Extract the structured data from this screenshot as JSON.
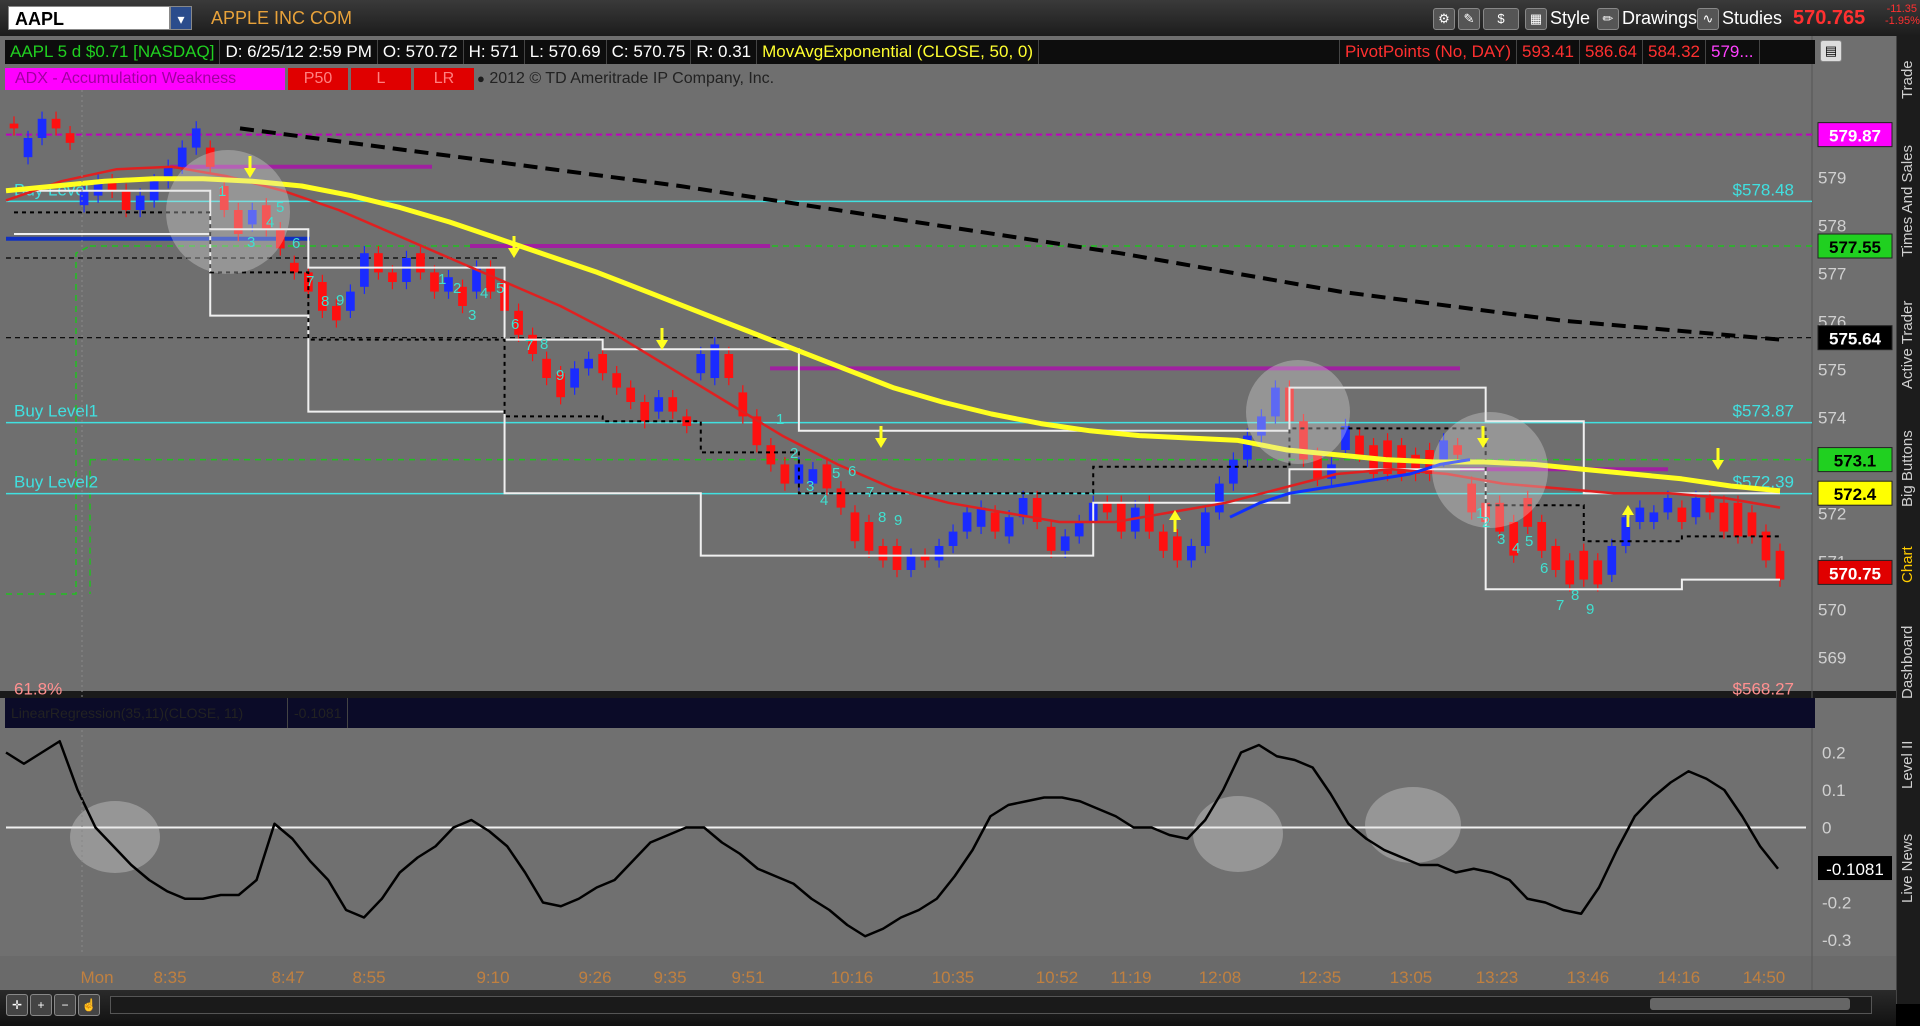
{
  "toolbar": {
    "symbol": "AAPL",
    "company": "APPLE INC COM",
    "style_label": "Style",
    "drawings_label": "Drawings",
    "studies_label": "Studies",
    "last_price": "570.765",
    "net_change": "-11.35",
    "net_change_pct": "-1.95%"
  },
  "info_bar": {
    "symbol_info": "AAPL 5 d $0.71 [NASDAQ]",
    "date": "D: 6/25/12 2:59 PM",
    "open": "O: 570.72",
    "high": "H: 571",
    "low": "L: 570.69",
    "close": "C: 570.75",
    "range": "R: 0.31",
    "mov_avg": "MovAvgExponential (CLOSE, 50, 0)",
    "pivot_label": "PivotPoints (No, DAY)",
    "pivot_values": [
      "593.41",
      "586.64",
      "584.32",
      "579..."
    ]
  },
  "study_bar": {
    "accdist": "ADX - Accumulation Weakness",
    "tags": [
      "P50",
      "L",
      "LR"
    ],
    "copyright": "2012 © TD Ameritrade IP Company, Inc."
  },
  "lower_header": {
    "study": "LinearRegression(35,11)(CLOSE, 11)",
    "value": "-0.1081"
  },
  "right_tabs": [
    "Trade",
    "Times And Sales",
    "Active Trader",
    "Big Buttons",
    "Chart",
    "Dashboard",
    "Level II",
    "Live News"
  ],
  "chart_data": [
    {
      "type": "candlestick",
      "y_ticks": [
        569,
        570,
        571,
        572,
        573,
        574,
        575,
        576,
        577,
        578,
        579
      ],
      "ylim": [
        568.3,
        580.8
      ],
      "x_ticks": [
        "Mon",
        "8:35",
        "8:47",
        "8:55",
        "9:10",
        "9:26",
        "9:35",
        "9:51",
        "10:16",
        "10:35",
        "10:52",
        "11:19",
        "12:08",
        "12:35",
        "13:05",
        "13:23",
        "13:46",
        "14:16",
        "14:50"
      ],
      "reference_lines": [
        {
          "label": "Buy Level",
          "value": "$578.48",
          "y": 578.48,
          "color": "#40e0e0"
        },
        {
          "label": "Buy Level1",
          "value": "$573.87",
          "y": 573.87,
          "color": "#40e0e0"
        },
        {
          "label": "Buy Level2",
          "value": "$572.39",
          "y": 572.39,
          "color": "#40e0e0"
        },
        {
          "label": "61.8%",
          "value": "$568.27",
          "y": 568.27,
          "color": "#ff9090"
        }
      ],
      "price_bubbles": [
        {
          "value": "579.87",
          "y": 579.87,
          "bg": "#ff00ff",
          "fg": "#ffffff"
        },
        {
          "value": "577.55",
          "y": 577.55,
          "bg": "#20d020",
          "fg": "#000000"
        },
        {
          "value": "575.64",
          "y": 575.64,
          "bg": "#000000",
          "fg": "#ffffff"
        },
        {
          "value": "573.1",
          "y": 573.1,
          "bg": "#20d020",
          "fg": "#000000"
        },
        {
          "value": "572.4",
          "y": 572.4,
          "bg": "#ffff00",
          "fg": "#000000"
        },
        {
          "value": "570.75",
          "y": 570.75,
          "bg": "#e00000",
          "fg": "#ffffff"
        }
      ],
      "candles": [
        [
          580.1,
          580.0
        ],
        [
          579.4,
          579.8
        ],
        [
          579.8,
          580.2
        ],
        [
          580.2,
          580.0
        ],
        [
          579.9,
          579.7
        ],
        [
          578.4,
          578.7
        ],
        [
          578.6,
          578.9
        ],
        [
          578.9,
          578.7
        ],
        [
          578.7,
          578.3
        ],
        [
          578.3,
          578.6
        ],
        [
          578.5,
          578.9
        ],
        [
          578.9,
          579.2
        ],
        [
          579.2,
          579.6
        ],
        [
          579.6,
          580.0
        ],
        [
          579.6,
          579.2
        ],
        [
          578.8,
          578.3
        ],
        [
          578.3,
          577.8
        ],
        [
          578.0,
          578.3
        ],
        [
          578.4,
          577.9
        ],
        [
          577.9,
          577.5
        ],
        [
          577.2,
          577.0
        ],
        [
          577.0,
          576.6
        ],
        [
          576.8,
          576.2
        ],
        [
          576.3,
          576.0
        ],
        [
          576.2,
          576.6
        ],
        [
          576.7,
          577.4
        ],
        [
          577.4,
          577.0
        ],
        [
          577.0,
          576.8
        ],
        [
          576.8,
          577.3
        ],
        [
          577.4,
          577.0
        ],
        [
          577.0,
          576.6
        ],
        [
          576.6,
          576.9
        ],
        [
          576.7,
          576.3
        ],
        [
          576.6,
          577.1
        ],
        [
          577.1,
          576.6
        ],
        [
          576.8,
          576.2
        ],
        [
          576.2,
          575.7
        ],
        [
          575.7,
          575.3
        ],
        [
          575.2,
          574.8
        ],
        [
          574.9,
          574.4
        ],
        [
          574.6,
          575.0
        ],
        [
          575.0,
          575.2
        ],
        [
          575.3,
          574.9
        ],
        [
          574.9,
          574.6
        ],
        [
          574.6,
          574.3
        ],
        [
          574.3,
          573.9
        ],
        [
          574.1,
          574.4
        ],
        [
          574.4,
          574.1
        ],
        [
          574.0,
          573.8
        ],
        [
          574.9,
          575.3
        ],
        [
          574.8,
          575.5
        ],
        [
          575.3,
          574.8
        ],
        [
          574.5,
          574.0
        ],
        [
          574.0,
          573.4
        ],
        [
          573.4,
          573.0
        ],
        [
          573.0,
          572.6
        ],
        [
          572.6,
          573.0
        ],
        [
          572.6,
          572.9
        ],
        [
          573.0,
          572.5
        ],
        [
          572.5,
          572.1
        ],
        [
          572.0,
          571.4
        ],
        [
          571.8,
          571.2
        ],
        [
          571.3,
          571.0
        ],
        [
          571.3,
          570.8
        ],
        [
          570.8,
          571.1
        ],
        [
          571.1,
          571.0
        ],
        [
          571.0,
          571.3
        ],
        [
          571.3,
          571.6
        ],
        [
          571.6,
          572.0
        ],
        [
          571.7,
          572.1
        ],
        [
          572.0,
          571.6
        ],
        [
          571.5,
          571.9
        ],
        [
          571.9,
          572.3
        ],
        [
          572.3,
          571.8
        ],
        [
          571.7,
          571.2
        ],
        [
          571.2,
          571.5
        ],
        [
          571.5,
          571.8
        ],
        [
          571.8,
          572.2
        ],
        [
          572.2,
          572.0
        ],
        [
          572.2,
          571.6
        ],
        [
          571.6,
          572.1
        ],
        [
          572.2,
          571.6
        ],
        [
          571.6,
          571.2
        ],
        [
          571.5,
          571.0
        ],
        [
          571.0,
          571.3
        ],
        [
          571.3,
          572.0
        ],
        [
          572.0,
          572.6
        ],
        [
          572.6,
          573.1
        ],
        [
          573.1,
          573.6
        ],
        [
          573.6,
          574.0
        ],
        [
          574.0,
          574.6
        ],
        [
          574.6,
          573.9
        ],
        [
          573.9,
          573.1
        ],
        [
          573.2,
          572.7
        ],
        [
          572.7,
          573.0
        ],
        [
          573.3,
          573.8
        ],
        [
          573.6,
          573.2
        ],
        [
          573.4,
          572.8
        ],
        [
          573.5,
          572.8
        ],
        [
          573.4,
          572.8
        ],
        [
          573.2,
          572.8
        ],
        [
          573.3,
          572.8
        ],
        [
          573.1,
          573.5
        ],
        [
          573.4,
          573.2
        ],
        [
          572.6,
          572.0
        ],
        [
          572.2,
          571.8
        ],
        [
          572.2,
          571.6
        ],
        [
          571.8,
          571.1
        ],
        [
          572.3,
          571.7
        ],
        [
          571.8,
          571.2
        ],
        [
          571.3,
          570.8
        ],
        [
          571.0,
          570.5
        ],
        [
          571.2,
          570.6
        ],
        [
          571.0,
          570.5
        ],
        [
          570.7,
          571.3
        ],
        [
          571.3,
          571.9
        ],
        [
          571.8,
          572.1
        ],
        [
          571.8,
          572.0
        ],
        [
          572.0,
          572.3
        ],
        [
          572.1,
          571.8
        ],
        [
          571.9,
          572.3
        ],
        [
          572.3,
          572.0
        ],
        [
          572.2,
          571.6
        ],
        [
          572.2,
          571.5
        ],
        [
          572.0,
          571.5
        ],
        [
          571.6,
          571.0
        ],
        [
          571.2,
          570.6
        ]
      ],
      "ema_50": [
        578.7,
        578.8,
        578.9,
        578.95,
        578.95,
        578.9,
        578.8,
        578.6,
        578.35,
        578.05,
        577.7,
        577.35,
        577.0,
        576.6,
        576.2,
        575.8,
        575.4,
        575.0,
        574.6,
        574.3,
        574.05,
        573.85,
        573.7,
        573.6,
        573.55,
        573.5,
        573.3,
        573.2,
        573.1,
        573.05,
        573.05,
        573.0,
        572.9,
        572.8,
        572.7,
        572.55,
        572.45
      ],
      "ema_fast": [
        578.5,
        578.9,
        579.15,
        579.2,
        579.0,
        578.7,
        578.3,
        577.8,
        577.3,
        576.8,
        576.3,
        575.7,
        575.0,
        574.3,
        573.6,
        573.0,
        572.5,
        572.2,
        572.0,
        571.8,
        571.8,
        572.0,
        572.2,
        572.5,
        572.8,
        572.9,
        572.8,
        572.6,
        572.5,
        572.4,
        572.4,
        572.3,
        572.1
      ],
      "ema_slow": [
        578.4,
        578.6,
        578.8,
        579.0,
        579.1,
        579.2,
        579.2
      ],
      "blue_ma": [
        571.9,
        572.2,
        572.4,
        572.5,
        572.6,
        572.7,
        572.8,
        573.0,
        573.1
      ],
      "long_ma": [
        580.0,
        579.4,
        578.8,
        578.1,
        577.4,
        576.6,
        576.0,
        575.6
      ],
      "pivot_line_values": [
        579.87
      ],
      "step_upper": [
        578.7,
        578.7,
        577.9,
        577.1,
        577.1,
        575.6,
        575.4,
        575.4,
        573.7,
        573.7,
        573.7,
        573.7,
        573.7,
        574.6,
        574.6,
        573.9,
        572.4,
        572.4,
        572.4
      ],
      "step_lower": [
        577.8,
        577.8,
        576.1,
        574.1,
        574.1,
        572.4,
        572.4,
        571.1,
        571.1,
        571.1,
        571.1,
        572.2,
        572.2,
        572.9,
        572.9,
        570.4,
        570.4,
        570.6,
        570.6
      ],
      "counts": [
        "1",
        "2",
        "3",
        "4",
        "5",
        "6",
        "7",
        "8",
        "9"
      ],
      "annotations": [
        "Buy Level",
        "Buy Level1",
        "Buy Level2",
        "61.8%"
      ]
    },
    {
      "type": "line",
      "title": "LinearRegression",
      "y_ticks": [
        "0.2",
        "0.1",
        "0",
        "-0.1",
        "-0.2",
        "-0.3"
      ],
      "ylim": [
        -0.34,
        0.26
      ],
      "current_value": "-0.1081",
      "values": [
        0.2,
        0.17,
        0.2,
        0.23,
        0.1,
        0.0,
        -0.05,
        -0.1,
        -0.14,
        -0.17,
        -0.19,
        -0.19,
        -0.18,
        -0.18,
        -0.14,
        0.01,
        -0.03,
        -0.09,
        -0.14,
        -0.22,
        -0.24,
        -0.19,
        -0.12,
        -0.08,
        -0.05,
        -0.0,
        0.02,
        -0.01,
        -0.05,
        -0.12,
        -0.2,
        -0.21,
        -0.19,
        -0.16,
        -0.14,
        -0.09,
        -0.04,
        -0.02,
        0.0,
        0.0,
        -0.04,
        -0.07,
        -0.11,
        -0.13,
        -0.15,
        -0.19,
        -0.22,
        -0.26,
        -0.29,
        -0.27,
        -0.24,
        -0.22,
        -0.19,
        -0.13,
        -0.06,
        0.03,
        0.06,
        0.07,
        0.08,
        0.08,
        0.07,
        0.05,
        0.03,
        -0.0,
        0.0,
        -0.02,
        -0.03,
        0.02,
        0.1,
        0.2,
        0.22,
        0.19,
        0.18,
        0.16,
        0.09,
        0.01,
        -0.03,
        -0.06,
        -0.08,
        -0.1,
        -0.1,
        -0.12,
        -0.11,
        -0.12,
        -0.14,
        -0.19,
        -0.2,
        -0.22,
        -0.23,
        -0.16,
        -0.06,
        0.03,
        0.08,
        0.12,
        0.15,
        0.13,
        0.1,
        0.03,
        -0.05,
        -0.11
      ]
    }
  ]
}
